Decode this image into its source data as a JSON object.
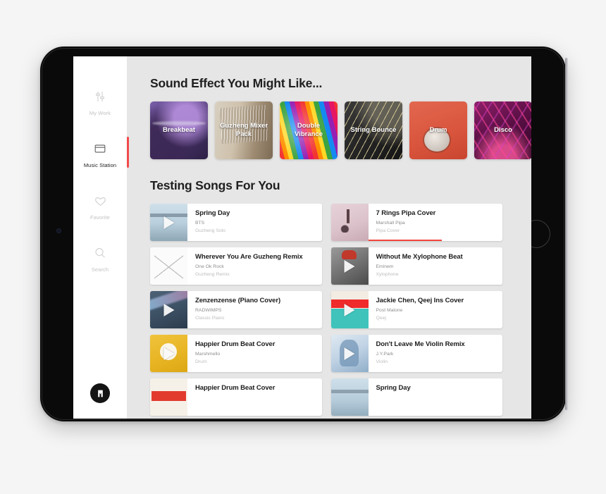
{
  "sidebar": {
    "items": [
      {
        "label": "My Work",
        "icon": "sliders-icon",
        "active": false
      },
      {
        "label": "Music Station",
        "icon": "window-icon",
        "active": true
      },
      {
        "label": "Favorite",
        "icon": "heart-icon",
        "active": false
      },
      {
        "label": "Search",
        "icon": "search-icon",
        "active": false
      }
    ],
    "logo": "brand-logo"
  },
  "sections": {
    "sound_effects_title": "Sound Effect You Might Like...",
    "songs_title": "Testing Songs For You"
  },
  "sound_effects": [
    {
      "label": "Breakbeat",
      "art": "tex-breakbeat"
    },
    {
      "label": "Guzheng Mixer Pack",
      "art": "tex-guzheng"
    },
    {
      "label": "Double Vibrance",
      "art": "tex-vibrance"
    },
    {
      "label": "String Bounce",
      "art": "tex-string"
    },
    {
      "label": "Drum",
      "art": "tex-drum"
    },
    {
      "label": "Disco",
      "art": "tex-disco"
    }
  ],
  "songs": [
    {
      "title": "Spring Day",
      "artist": "BTS",
      "genre": "Guzheng Solo",
      "art": "art-springday",
      "play": true,
      "progress": 0
    },
    {
      "title": "7 Rings Pipa Cover",
      "artist": "Marshall Pipa",
      "genre": "Pipa Cover",
      "art": "art-7rings",
      "play": false,
      "progress": 55
    },
    {
      "title": "Wherever You Are Guzheng Remix",
      "artist": "One Ok Rock",
      "genre": "Guzheng Remix",
      "art": "art-wherever",
      "play": false,
      "progress": 0
    },
    {
      "title": "Without Me Xylophone Beat",
      "artist": "Eminem",
      "genre": "Xylophone",
      "art": "art-withoutme",
      "play": true,
      "progress": 0
    },
    {
      "title": "Zenzenzense (Piano Cover)",
      "artist": "RADWIMPS",
      "genre": "Classic Piano",
      "art": "art-zenzen",
      "play": true,
      "progress": 0
    },
    {
      "title": "Jackie Chen, Qeej Ins Cover",
      "artist": "Post Malone",
      "genre": "Qeej",
      "art": "art-jackie",
      "play": true,
      "progress": 0
    },
    {
      "title": "Happier Drum Beat Cover",
      "artist": "Marshmello",
      "genre": "Drum",
      "art": "art-happier",
      "play": true,
      "progress": 0
    },
    {
      "title": "Don't Leave Me Violin Remix",
      "artist": "J.Y.Park",
      "genre": "Violin",
      "art": "art-dontleave",
      "play": true,
      "progress": 0
    },
    {
      "title": "Happier Drum Beat Cover",
      "artist": "",
      "genre": "",
      "art": "art-happier2",
      "play": false,
      "progress": 0
    },
    {
      "title": "Spring Day",
      "artist": "",
      "genre": "",
      "art": "art-springday2",
      "play": false,
      "progress": 0
    }
  ],
  "colors": {
    "accent_red": "#f2453d",
    "screen_bg": "#e6e6e6",
    "sidebar_bg": "#ffffff",
    "page_bg": "#f5f5f6"
  }
}
